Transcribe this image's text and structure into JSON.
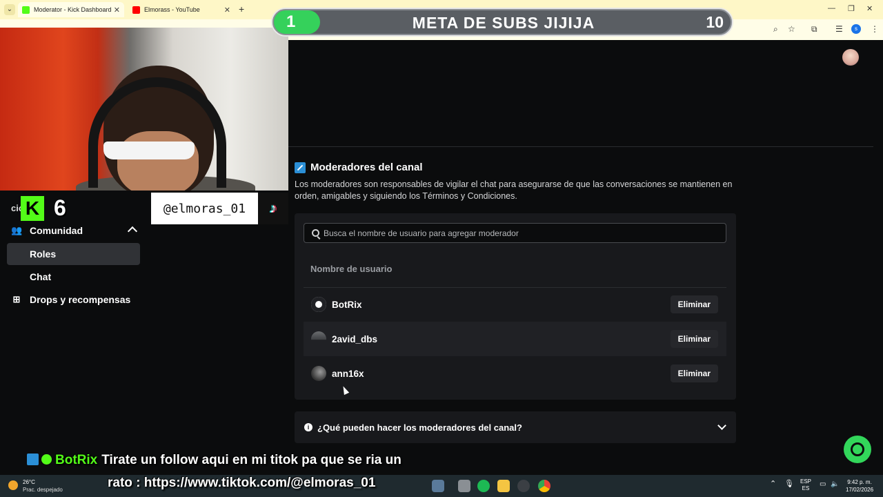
{
  "browser": {
    "tabs": [
      {
        "label": "Moderator - Kick Dashboard",
        "favicon": "kick-icon",
        "color": "#53fc18"
      },
      {
        "label": "Elmorass - YouTube",
        "favicon": "youtube-icon",
        "color": "#ff0000"
      }
    ],
    "new_tab": "+",
    "profile_initial": "s"
  },
  "sidebar": {
    "comunidad": "Comunidad",
    "roles": "Roles",
    "chat": "Chat",
    "drops": "Drops y recompensas",
    "fragment": "ción"
  },
  "section": {
    "title": "Moderadores del canal",
    "description": "Los moderadores son responsables de vigilar el chat para asegurarse de que las conversaciones se mantienen en orden, amigables y siguiendo los Términos y Condiciones."
  },
  "search": {
    "placeholder": "Busca el nombre de usuario para agregar moderador"
  },
  "table": {
    "header": "Nombre de usuario",
    "rows": [
      {
        "name": "BotRix",
        "action": "Eliminar"
      },
      {
        "name": "2avid_dbs",
        "action": "Eliminar"
      },
      {
        "name": "ann16x",
        "action": "Eliminar"
      }
    ]
  },
  "faq": {
    "question": "¿Qué pueden hacer los moderadores del canal?"
  },
  "overlay": {
    "goal": {
      "current": "1",
      "title": "META DE SUBS JIJIJA",
      "target": "10",
      "progress": 0.1
    },
    "kick_count": "6",
    "kick_letter": "K",
    "tiktok_handle": "@elmoras_01",
    "chat": {
      "user": "BotRix",
      "message_line1": "Tirate un follow aqui en mi titok pa que se ria un",
      "message_line2": "rato : https://www.tiktok.com/@elmoras_01"
    }
  },
  "taskbar": {
    "temperature": "26°C",
    "weather": "Prac. despejado",
    "lang1": "ESP",
    "lang2": "ES",
    "time": "9:42 p. m.",
    "date": "17/02/2026"
  }
}
